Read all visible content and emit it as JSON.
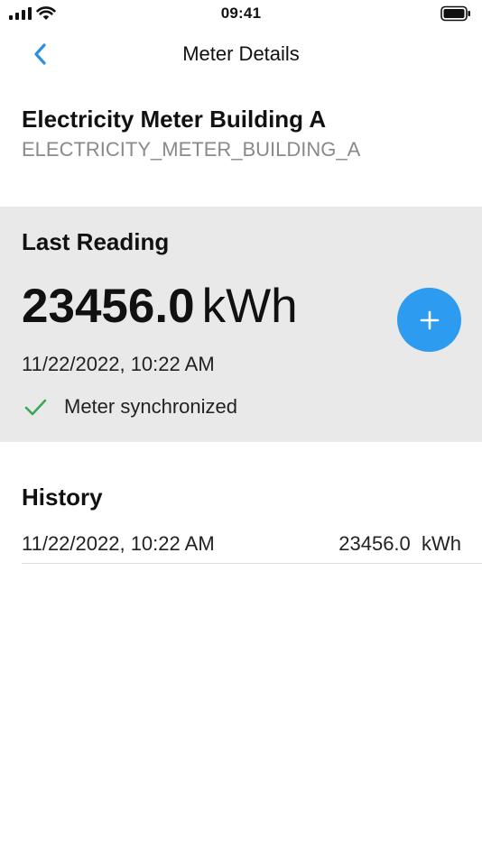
{
  "status_bar": {
    "time": "09:41"
  },
  "nav": {
    "title": "Meter Details"
  },
  "meter": {
    "name": "Electricity Meter Building A",
    "id": "ELECTRICITY_METER_BUILDING_A"
  },
  "last_reading": {
    "heading": "Last Reading",
    "value": "23456.0",
    "unit": "kWh",
    "date": "11/22/2022, 10:22 AM",
    "sync_status": "Meter synchronized"
  },
  "history": {
    "heading": "History",
    "rows": [
      {
        "date": "11/22/2022, 10:22 AM",
        "value": "23456.0  kWh"
      }
    ]
  },
  "colors": {
    "accent": "#2d9bf0",
    "back_chevron": "#2d8fe0",
    "check": "#3aa757",
    "panel_background": "#e9e9e9",
    "secondary_text": "#8a8a8a"
  },
  "icons": {
    "back": "chevron-left-icon",
    "add": "plus-icon",
    "sync": "check-icon",
    "signal": "signal-icon",
    "wifi": "wifi-icon",
    "battery": "battery-icon"
  }
}
